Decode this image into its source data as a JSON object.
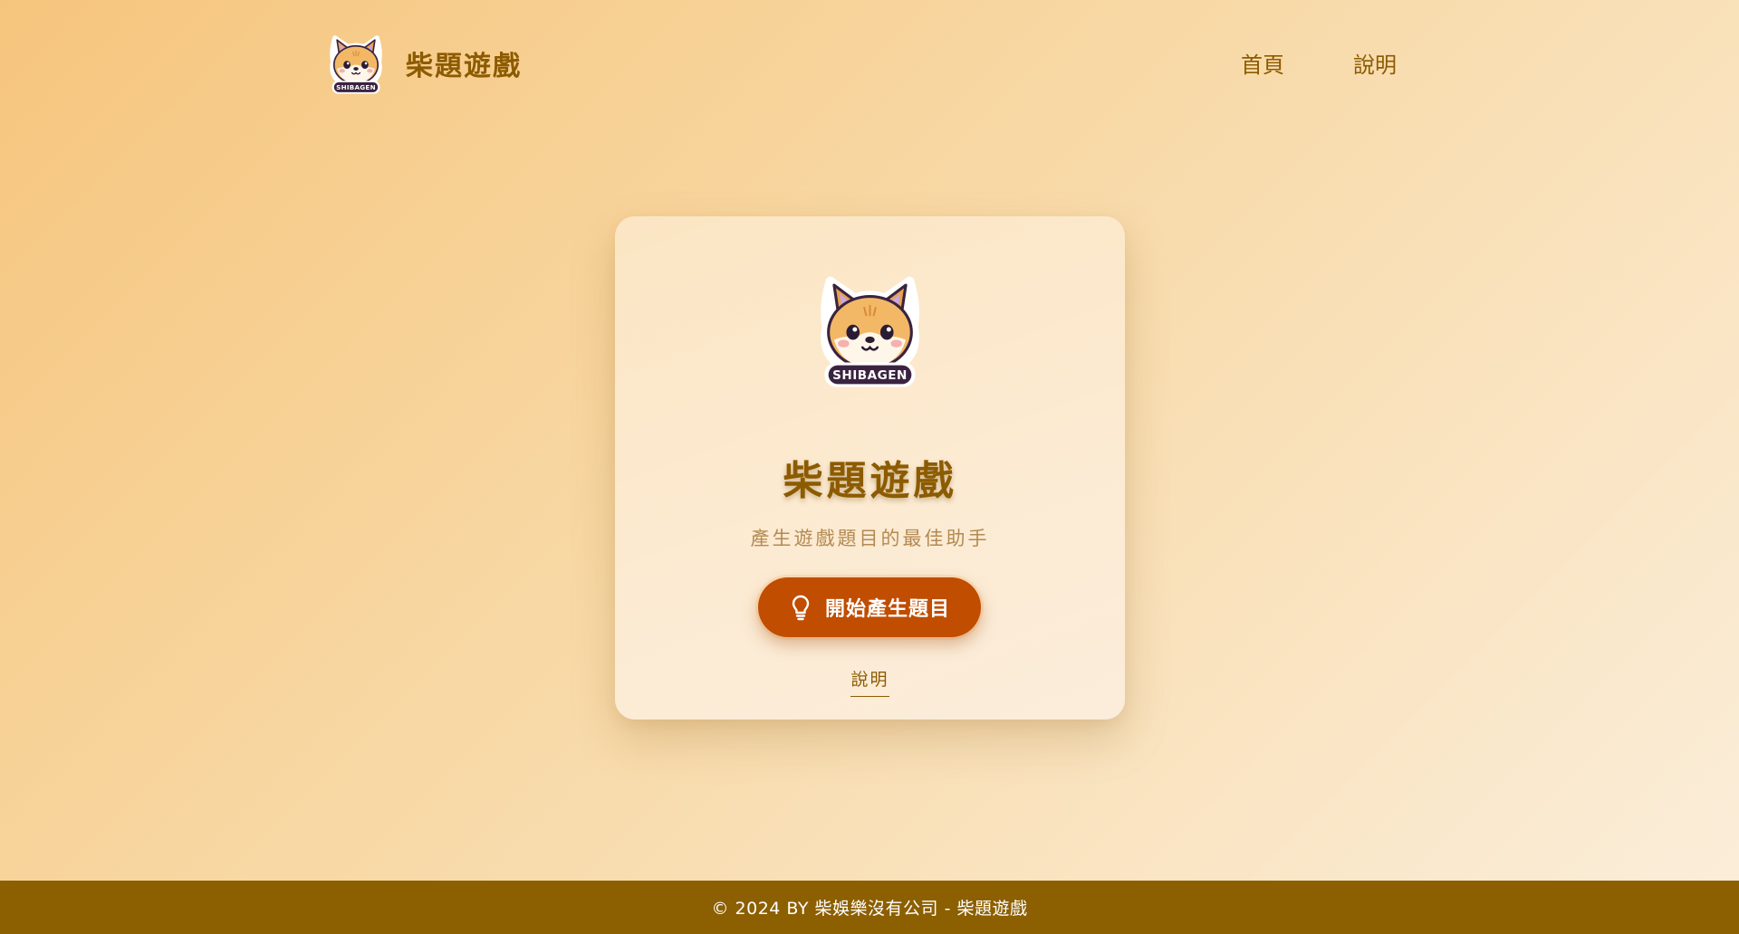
{
  "header": {
    "brand_name": "柴題遊戲",
    "logo_badge_text": "SHIBAGEN",
    "nav": [
      {
        "label": "首頁"
      },
      {
        "label": "說明"
      }
    ]
  },
  "hero": {
    "logo_badge_text": "SHIBAGEN",
    "title": "柴題遊戲",
    "subtitle": "產生遊戲題目的最佳助手",
    "start_button_label": "開始產生題目",
    "start_button_icon": "lightbulb-icon",
    "help_link_label": "說明"
  },
  "footer": {
    "copyright": "© 2024 BY 柴娛樂沒有公司 - 柴題遊戲"
  },
  "colors": {
    "brand_brown": "#8c5b00",
    "button_orange": "#c04d00",
    "footer_bg": "#8c5f00",
    "background_start": "#f6c57d",
    "background_end": "#fbeedb"
  }
}
